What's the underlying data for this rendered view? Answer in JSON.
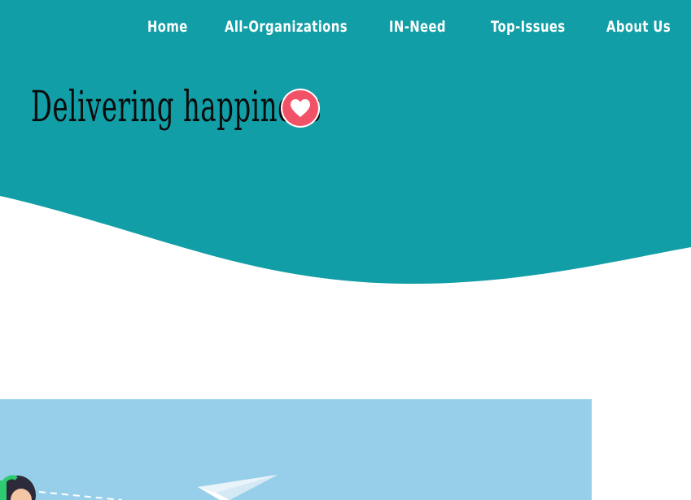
{
  "nav": {
    "items": [
      {
        "label": "Home"
      },
      {
        "label": "All-Organizations"
      },
      {
        "label": "IN-Need"
      },
      {
        "label": "Top-Issues"
      },
      {
        "label": "About Us"
      }
    ]
  },
  "hero": {
    "title": "Delivering  happiness",
    "icon": "heart-icon"
  },
  "colors": {
    "hero_bg": "#129ea6",
    "heart_badge": "#f25268",
    "illustration_bg": "#97cfea",
    "nav_text": "#ffffff",
    "title_text": "#0b0b0b"
  }
}
